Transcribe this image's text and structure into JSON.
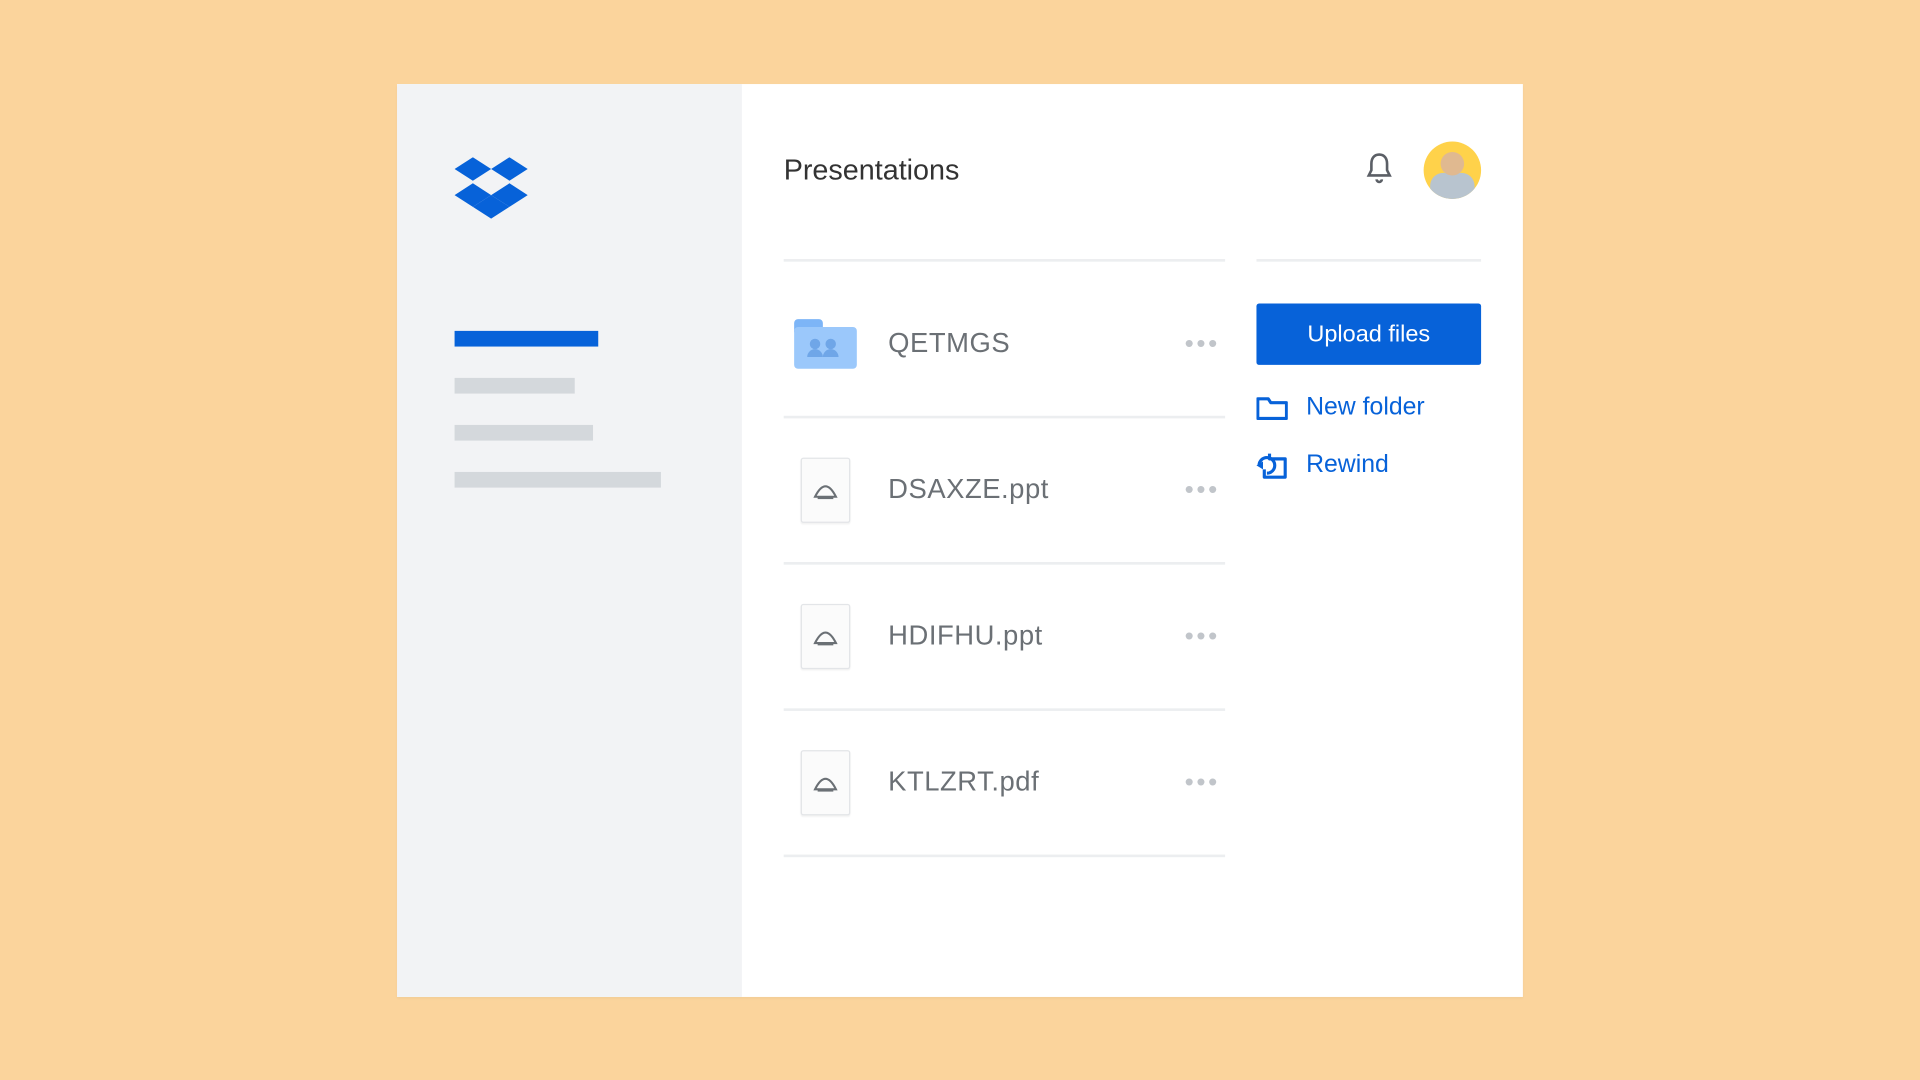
{
  "header": {
    "title": "Presentations"
  },
  "files": [
    {
      "name": "QETMGS",
      "type": "folder"
    },
    {
      "name": "DSAXZE.ppt",
      "type": "file"
    },
    {
      "name": "HDIFHU.ppt",
      "type": "file"
    },
    {
      "name": "KTLZRT.pdf",
      "type": "file"
    }
  ],
  "actions": {
    "upload_label": "Upload files",
    "new_folder_label": "New folder",
    "rewind_label": "Rewind"
  },
  "colors": {
    "accent": "#0762d9",
    "page_bg": "#fbd49c",
    "sidebar_bg": "#f2f3f5"
  }
}
